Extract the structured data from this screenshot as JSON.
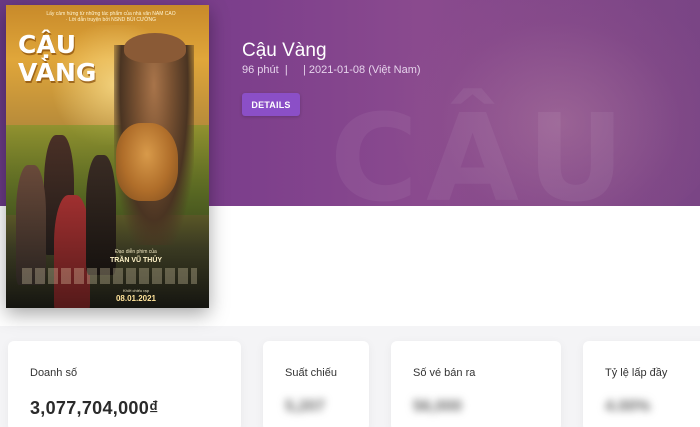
{
  "movie": {
    "title": "Cậu Vàng",
    "meta": "96 phút  |     | 2021-01-08 (Việt Nam)",
    "details_label": "DETAILS"
  },
  "poster": {
    "title": "CẬU VÀNG",
    "top_text": "Lấy cảm hứng từ những tác phẩm của nhà văn NAM CAO · Lời dẫn truyện bởi NSND BÙI CƯỜNG",
    "director_label": "Đạo diễn phim của",
    "director_name": "TRẦN VŨ THỦY",
    "release_label": "Khởi chiếu rạp",
    "release_date": "08.01.2021"
  },
  "stats": [
    {
      "label": "Doanh số",
      "value": "3,077,704,000₫",
      "blurred": false
    },
    {
      "label": "Suất chiếu",
      "value": "5,207",
      "blurred": true
    },
    {
      "label": "Số vé bán ra",
      "value": "56,000",
      "blurred": true
    },
    {
      "label": "Tỷ lệ lấp đầy",
      "value": "4.00%",
      "blurred": true
    }
  ],
  "colors": {
    "hero_purple": "#7d3f8c",
    "button": "#8b4fc7"
  }
}
